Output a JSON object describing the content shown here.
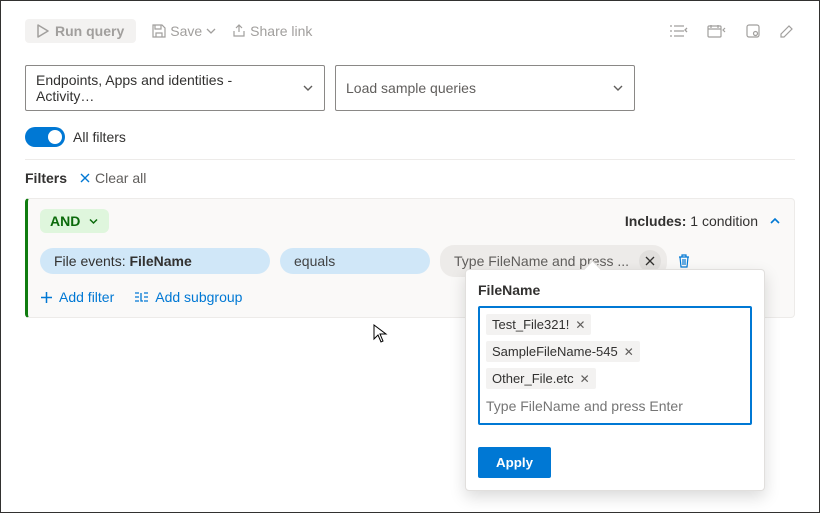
{
  "toolbar": {
    "run": "Run query",
    "save": "Save",
    "share": "Share link"
  },
  "dropdowns": {
    "schema": "Endpoints, Apps and identities - Activity…",
    "samples": "Load sample queries"
  },
  "filters_toggle_label": "All filters",
  "filters_label": "Filters",
  "clear_all": "Clear all",
  "group": {
    "operator": "AND",
    "includes_prefix": "Includes:",
    "includes_count": "1 condition",
    "cond_field_prefix": "File events: ",
    "cond_field_bold": "FileName",
    "cond_op": "equals",
    "cond_value_placeholder": "Type FileName and press ...",
    "add_filter": "Add filter",
    "add_subgroup": "Add subgroup"
  },
  "popup": {
    "title": "FileName",
    "tags": [
      "Test_File321!",
      "SampleFileName-545",
      "Other_File.etc"
    ],
    "input_placeholder": "Type FileName and press Enter",
    "apply": "Apply"
  }
}
